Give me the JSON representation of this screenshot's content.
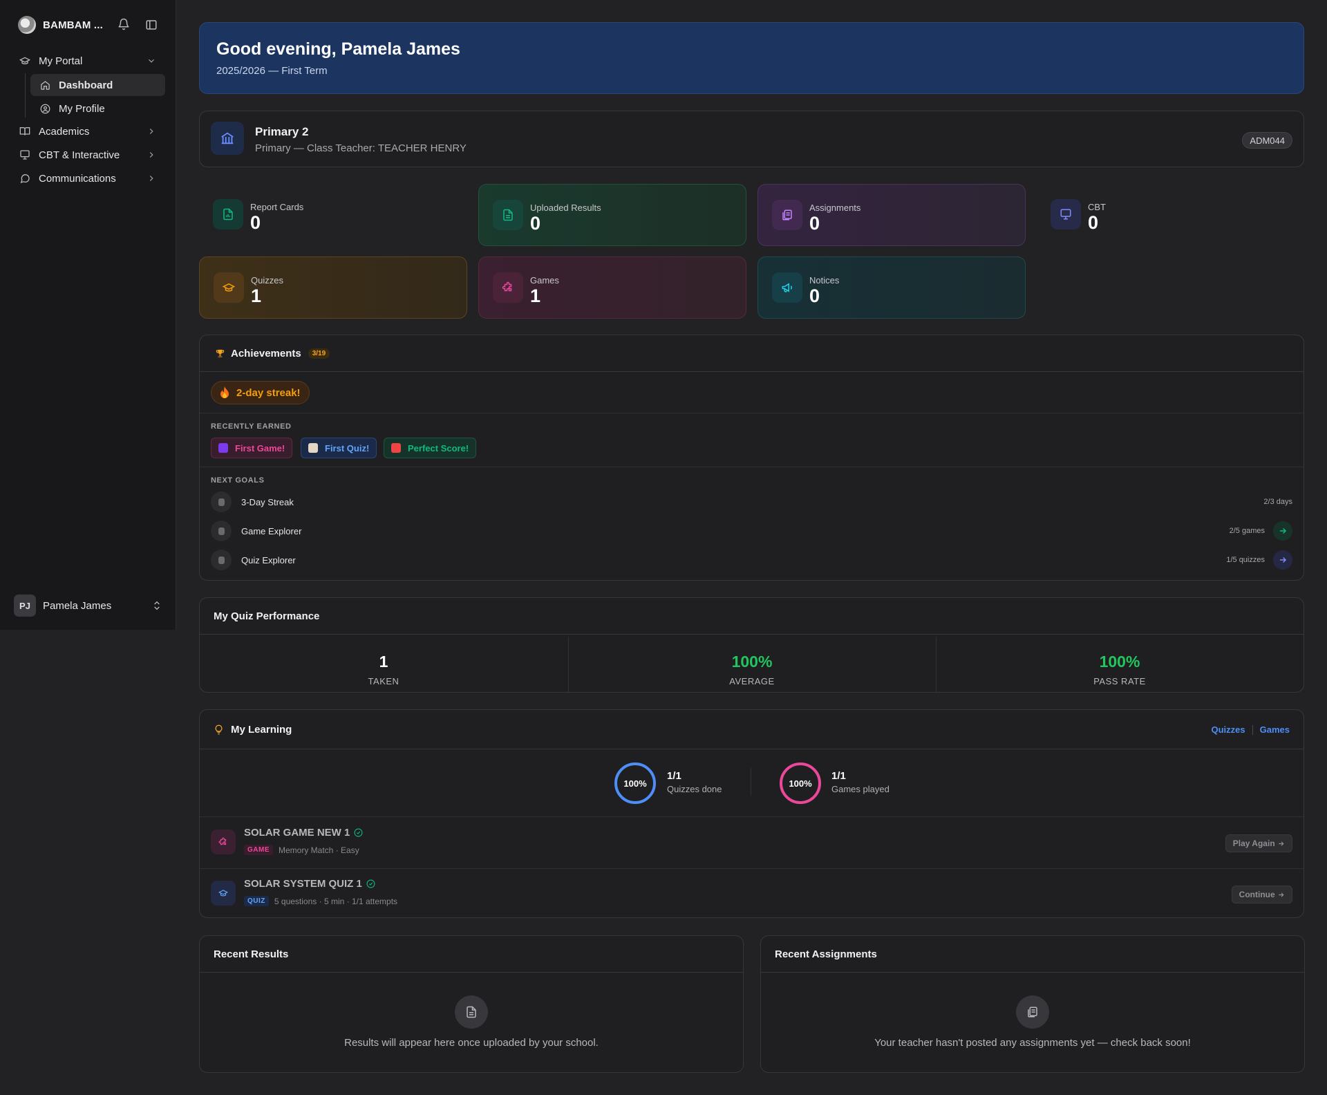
{
  "sidebar": {
    "school_name": "BAMBAM ...",
    "nav": {
      "my_portal": "My Portal",
      "dashboard": "Dashboard",
      "my_profile": "My Profile",
      "academics": "Academics",
      "cbt": "CBT & Interactive",
      "communications": "Communications"
    },
    "user": {
      "initials": "PJ",
      "name": "Pamela James"
    }
  },
  "greeting": {
    "title": "Good evening, Pamela James",
    "term": "2025/2026 — First Term"
  },
  "class_card": {
    "title": "Primary 2",
    "subtitle": "Primary — Class Teacher: TEACHER HENRY",
    "admission_no": "ADM044"
  },
  "stats": [
    {
      "label": "Report Cards",
      "value": "0",
      "icon": "report-card-icon",
      "color": "#10b981"
    },
    {
      "label": "Uploaded Results",
      "value": "0",
      "icon": "file-icon",
      "color": "#10b981"
    },
    {
      "label": "Assignments",
      "value": "0",
      "icon": "clipboard-icon",
      "color": "#a855f7"
    },
    {
      "label": "CBT",
      "value": "0",
      "icon": "monitor-icon",
      "color": "#6366f1"
    },
    {
      "label": "Quizzes",
      "value": "1",
      "icon": "graduation-cap-icon",
      "color": "#f59e0b"
    },
    {
      "label": "Games",
      "value": "1",
      "icon": "puzzle-icon",
      "color": "#ec4899"
    },
    {
      "label": "Notices",
      "value": "0",
      "icon": "megaphone-icon",
      "color": "#06b6d4"
    }
  ],
  "achievements": {
    "title": "Achievements",
    "count": "3/19",
    "streak": "2-day streak!",
    "recently_earned_label": "RECENTLY EARNED",
    "badges": [
      {
        "label": "First Game!",
        "color": "#ec4899"
      },
      {
        "label": "First Quiz!",
        "color": "#60a5fa"
      },
      {
        "label": "Perfect Score!",
        "color": "#10b981"
      }
    ],
    "next_goals_label": "NEXT GOALS",
    "goals": [
      {
        "name": "3-Day Streak",
        "progress": "2/3 days"
      },
      {
        "name": "Game Explorer",
        "progress": "2/5 games"
      },
      {
        "name": "Quiz Explorer",
        "progress": "1/5 quizzes"
      }
    ]
  },
  "quiz_performance": {
    "title": "My Quiz Performance",
    "taken": {
      "value": "1",
      "label": "TAKEN"
    },
    "average": {
      "value": "100%",
      "label": "AVERAGE"
    },
    "pass_rate": {
      "value": "100%",
      "label": "PASS RATE"
    }
  },
  "learning": {
    "title": "My Learning",
    "link_quizzes": "Quizzes",
    "link_games": "Games",
    "quizzes_ring": {
      "percent": "100%",
      "fraction_value": 1.0,
      "count": "1/1",
      "label": "Quizzes done",
      "color": "#4e8ef7"
    },
    "games_ring": {
      "percent": "100%",
      "fraction_value": 1.0,
      "count": "1/1",
      "label": "Games played",
      "color": "#ec4899"
    },
    "items": [
      {
        "title": "SOLAR GAME NEW 1",
        "tag": "GAME",
        "meta1": "Memory Match",
        "meta2": "· Easy",
        "meta3": "",
        "action": "Play Again"
      },
      {
        "title": "SOLAR SYSTEM QUIZ 1",
        "tag": "QUIZ",
        "meta1": "5 questions",
        "meta2": "· 5 min",
        "meta3": "· 1/1 attempts",
        "action": "Continue"
      }
    ]
  },
  "recent_results": {
    "title": "Recent Results",
    "empty": "Results will appear here once uploaded by your school."
  },
  "recent_assignments": {
    "title": "Recent Assignments",
    "empty": "Your teacher hasn't posted any assignments yet — check back soon!"
  }
}
